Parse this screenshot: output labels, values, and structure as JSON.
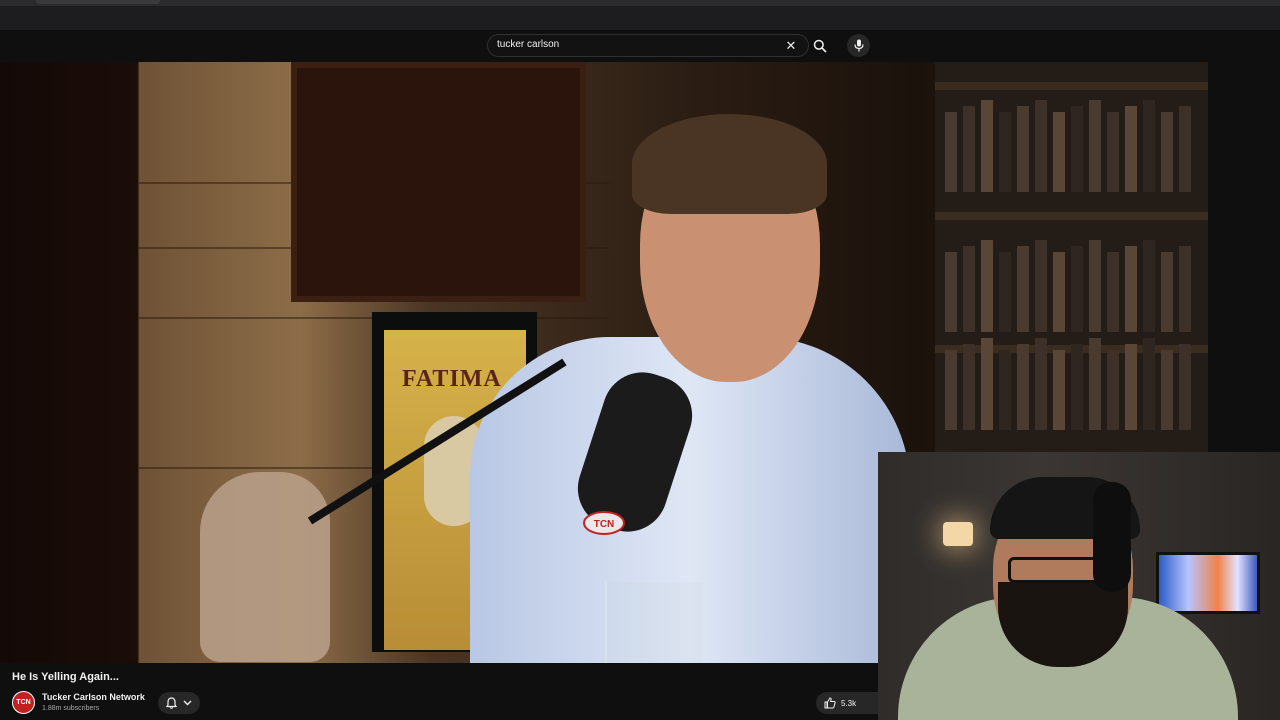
{
  "search": {
    "query": "tucker carlson"
  },
  "video": {
    "title": "He Is Yelling Again...",
    "poster_text": "FATIMA",
    "mic_badge": "TCN"
  },
  "channel": {
    "avatar_text": "TCN",
    "name": "Tucker Carlson Network",
    "subscribers": "1.88m subscribers"
  },
  "actions": {
    "like_count": "5.3k"
  },
  "icons": [
    "close-icon",
    "search-icon",
    "mic-icon",
    "bell-icon",
    "chevron-down-icon",
    "thumbs-up-icon"
  ],
  "colors": {
    "background": "#0f0f0f",
    "channel_avatar": "#c22121",
    "chip": "#272727"
  }
}
